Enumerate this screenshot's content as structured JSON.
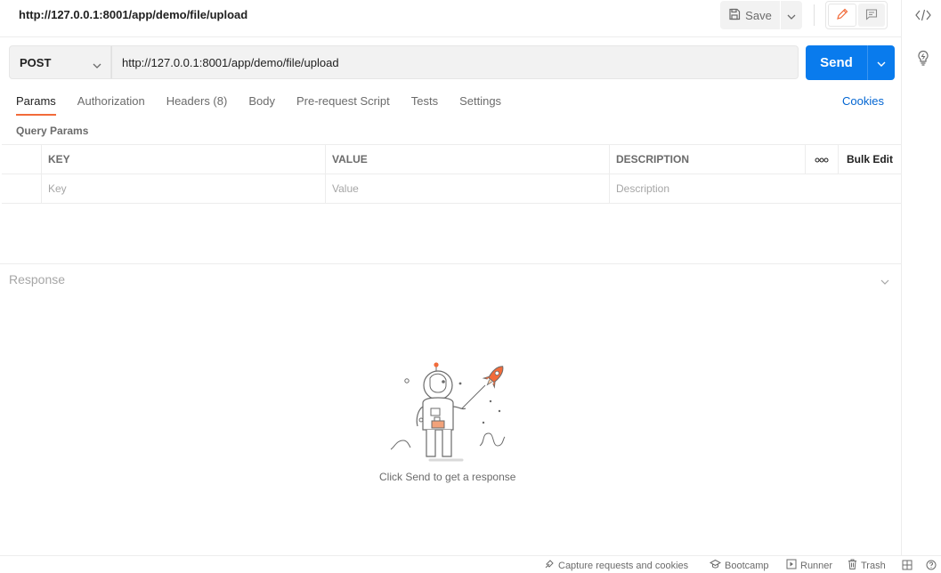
{
  "header": {
    "title": "http://127.0.0.1:8001/app/demo/file/upload",
    "save_label": "Save"
  },
  "request": {
    "method": "POST",
    "url": "http://127.0.0.1:8001/app/demo/file/upload",
    "send_label": "Send"
  },
  "tabs": [
    {
      "label": "Params",
      "active": true
    },
    {
      "label": "Authorization"
    },
    {
      "label": "Headers (8)"
    },
    {
      "label": "Body"
    },
    {
      "label": "Pre-request Script"
    },
    {
      "label": "Tests"
    },
    {
      "label": "Settings"
    }
  ],
  "cookies_label": "Cookies",
  "query_params": {
    "label": "Query Params",
    "headers": {
      "key": "KEY",
      "value": "VALUE",
      "description": "DESCRIPTION",
      "bulk_edit": "Bulk Edit"
    },
    "placeholders": {
      "key": "Key",
      "value": "Value",
      "description": "Description"
    }
  },
  "response": {
    "title": "Response",
    "hint": "Click Send to get a response"
  },
  "statusbar": {
    "capture": "Capture requests and cookies",
    "bootcamp": "Bootcamp",
    "runner": "Runner",
    "trash": "Trash"
  },
  "colors": {
    "accent": "#097bed",
    "tab_indicator": "#f26b3a",
    "link": "#0265d2"
  },
  "icons": [
    "save-icon",
    "chevron-down-icon",
    "pencil-icon",
    "comment-icon",
    "code-icon",
    "lightbulb-icon",
    "more-icon",
    "capture-icon",
    "bootcamp-icon",
    "runner-icon",
    "trash-icon",
    "layout-icon",
    "help-icon"
  ]
}
